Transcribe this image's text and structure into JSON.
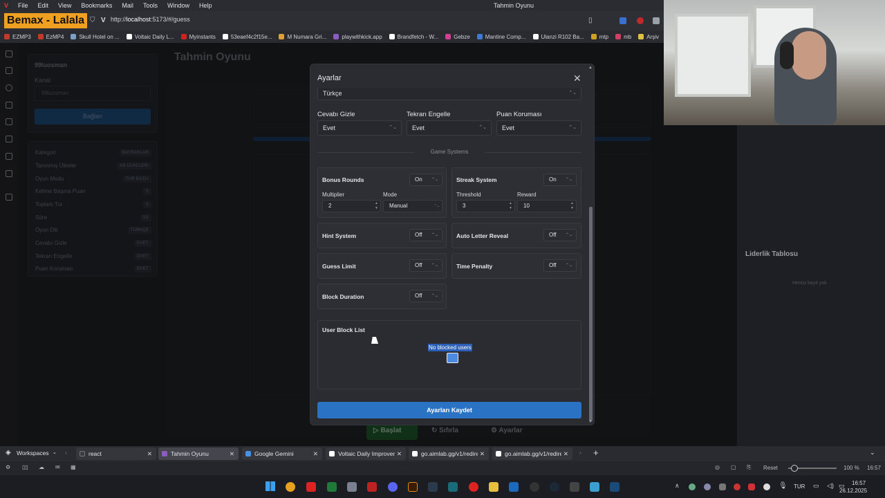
{
  "menubar": {
    "items": [
      "File",
      "Edit",
      "View",
      "Bookmarks",
      "Mail",
      "Tools",
      "Window",
      "Help"
    ],
    "window_title": "Tahmin Oyunu"
  },
  "address": {
    "site_badge": "Bemax - Lalala",
    "url_prefix": "http://",
    "url_host": "localhost",
    "url_rest": ":5173/#/guess"
  },
  "bookmarks": [
    {
      "label": "EZMP3",
      "color": "#c0392b"
    },
    {
      "label": "EzMP4",
      "color": "#c0392b"
    },
    {
      "label": "Skull Hotel on ...",
      "color": "#7aa0c8"
    },
    {
      "label": "Voltaic Daily L...",
      "color": "#ffffff"
    },
    {
      "label": "Myinstants",
      "color": "#cc2222"
    },
    {
      "label": "53eaef4c2f15e...",
      "color": "#ffffff"
    },
    {
      "label": "M Numara Gri...",
      "color": "#e0a030"
    },
    {
      "label": "playwithkick.app",
      "color": "#8a5cc0"
    },
    {
      "label": "Brandfetch - W...",
      "color": "#ffffff"
    },
    {
      "label": "Gebze",
      "color": "#d04090"
    },
    {
      "label": "Mantine Comp...",
      "color": "#3a7bd5"
    },
    {
      "label": "Ulanzi R102 Ba...",
      "color": "#ffffff"
    },
    {
      "label": "mtp",
      "color": "#d0a020"
    },
    {
      "label": "mb",
      "color": "#d04060"
    },
    {
      "label": "Arşiv",
      "color": "#e0c040"
    }
  ],
  "sidebar": {
    "username": "99luosman",
    "channel_label": "Kanal",
    "channel_placeholder": "99luosman",
    "connect_button": "Bağlan",
    "info": [
      {
        "key": "Kategori",
        "value": "BAYRAKLAR"
      },
      {
        "key": "Tanınmış Ülkeler",
        "value": "AB ÜLKELERI"
      },
      {
        "key": "Oyun Modu",
        "value": "TUR BAZLI"
      },
      {
        "key": "Kelime Başına Puan",
        "value": "5"
      },
      {
        "key": "Toplam Tur",
        "value": "5"
      },
      {
        "key": "Süre",
        "value": "5S"
      },
      {
        "key": "Oyun Dili",
        "value": "TÜRKÇE"
      },
      {
        "key": "Cevabı Gizle",
        "value": "EVET"
      },
      {
        "key": "Tekrarı Engelle",
        "value": "EVET"
      },
      {
        "key": "Puan Koruması",
        "value": "EVET"
      }
    ]
  },
  "page": {
    "title": "Tahmin Oyunu",
    "leaderboard_title": "Liderlik Tablosu",
    "leaderboard_empty": "Henüz kayıt yok",
    "start_button": "Başlat",
    "reset_button": "Sıfırla",
    "settings_button": "Ayarlar"
  },
  "modal": {
    "title": "Ayarlar",
    "language_value": "Türkçe",
    "hide_answer_label": "Cevabı Gizle",
    "hide_answer_value": "Evet",
    "block_repeat_label": "Tekrarı Engelle",
    "block_repeat_value": "Evet",
    "score_protect_label": "Puan Koruması",
    "score_protect_value": "Evet",
    "section_title": "Game Systems",
    "bonus_rounds": {
      "name": "Bonus Rounds",
      "value": "On",
      "multiplier_label": "Multiplier",
      "multiplier_value": "2",
      "mode_label": "Mode",
      "mode_value": "Manual"
    },
    "streak_system": {
      "name": "Streak System",
      "value": "On",
      "threshold_label": "Threshold",
      "threshold_value": "3",
      "reward_label": "Reward",
      "reward_value": "10"
    },
    "hint_system": {
      "name": "Hint System",
      "value": "Off"
    },
    "auto_letter_reveal": {
      "name": "Auto Letter Reveal",
      "value": "Off"
    },
    "guess_limit": {
      "name": "Guess Limit",
      "value": "Off"
    },
    "time_penalty": {
      "name": "Time Penalty",
      "value": "Off"
    },
    "block_duration": {
      "name": "Block Duration",
      "value": "Off"
    },
    "block_list_title": "User Block List",
    "block_list_empty": "No blocked users",
    "save_button": "Ayarları Kaydet"
  },
  "tabs": {
    "workspaces": "Workspaces",
    "items": [
      {
        "label": "react",
        "color": "#3a3c42"
      },
      {
        "label": "Tahmin Oyunu",
        "color": "#8a5cc0"
      },
      {
        "label": "Google Gemini",
        "color": "#4a8fe0"
      },
      {
        "label": "Voltaic Daily Improven",
        "color": "#ffffff"
      },
      {
        "label": "go.aimlab.gg/v1/redire",
        "color": "#ffffff"
      },
      {
        "label": "go.aimlab.gg/v1/redire",
        "color": "#ffffff"
      }
    ]
  },
  "status": {
    "reset": "Reset",
    "zoom": "100 %",
    "time": "16:57"
  },
  "taskbar": {
    "lang": "TUR",
    "clock_time": "16:57",
    "clock_date": "26.12.2025"
  }
}
